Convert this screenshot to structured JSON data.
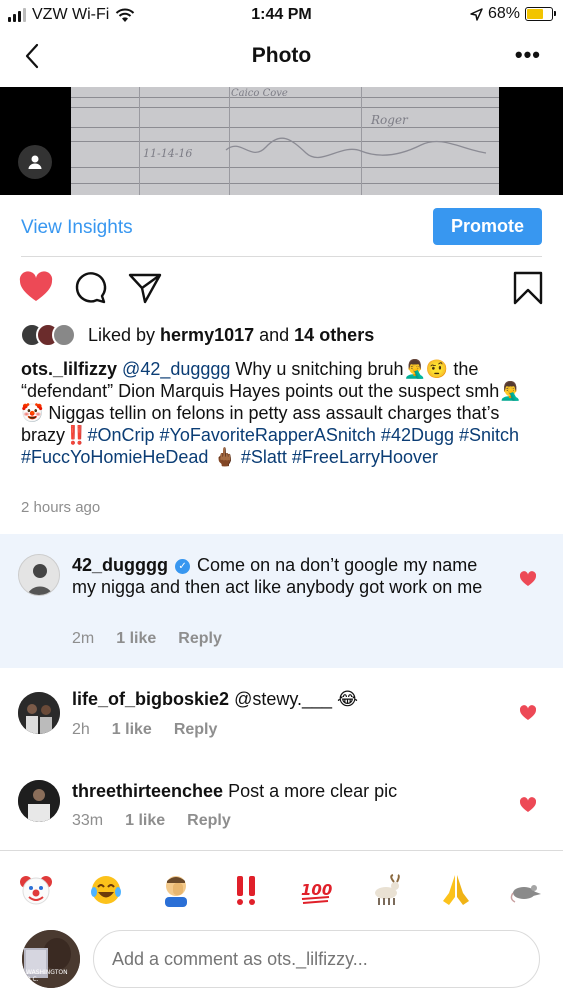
{
  "status_bar": {
    "carrier": "VZW Wi-Fi",
    "time": "1:44 PM",
    "battery": "68%",
    "battery_level": 0.68,
    "icons": [
      "signal-icon",
      "wifi-icon",
      "location-arrow-icon",
      "battery-icon"
    ]
  },
  "nav": {
    "title": "Photo",
    "more": "•••"
  },
  "photo": {
    "handwriting_1": "Caico Cove",
    "handwriting_2": "11-14-16",
    "handwriting_3": "Roger"
  },
  "insights": {
    "view_insights": "View Insights",
    "promote": "Promote"
  },
  "likes": {
    "prefix": "Liked by ",
    "user": "hermy1017",
    "middle": " and ",
    "others": "14 others"
  },
  "caption": {
    "username": "ots._lilfizzy",
    "mention": "@42_dugggg",
    "text_1": " Why u snitching bruh🤦‍♂️🤨 the “defendant” Dion Marquis Hayes points out the suspect smh🤦‍♂️🤡 Niggas tellin on felons in petty ass assault charges that’s brazy‼️",
    "tags_1": "#OnCrip #YoFavoriteRapperASnitch #42Dugg #Snitch #FuccYoHomieHeDead",
    "emoji_2": "🖕🏾",
    "tags_2": "#Slatt #FreeLarryHoover"
  },
  "timestamp": "2 hours ago",
  "comments": [
    {
      "username": "42_dugggg",
      "verified": true,
      "text": "Come on na don’t google my name my nigga and then act like anybody got work on me",
      "time": "2m",
      "likes": "1 like",
      "reply": "Reply"
    },
    {
      "username": "life_of_bigboskie2",
      "verified": false,
      "text": "@stewy.___ 😂",
      "time": "2h",
      "likes": "1 like",
      "reply": "Reply"
    },
    {
      "username": "threethirteenchee",
      "verified": false,
      "text": "Post a more clear pic",
      "time": "33m",
      "likes": "1 like",
      "reply": "Reply"
    }
  ],
  "emoji_bar": [
    "🤡",
    "😂",
    "🤦‍♂️",
    "‼️",
    "💯",
    "🐐",
    "🙏",
    "🐀"
  ],
  "compose": {
    "placeholder": "Add a comment as ots._lilfizzy...",
    "avatar_caption": "WASHINGTON D.C."
  },
  "colors": {
    "accent": "#3897f0",
    "heart": "#ed4956",
    "hashtag": "#0b3d75",
    "highlight_bg": "#eef4fc"
  }
}
